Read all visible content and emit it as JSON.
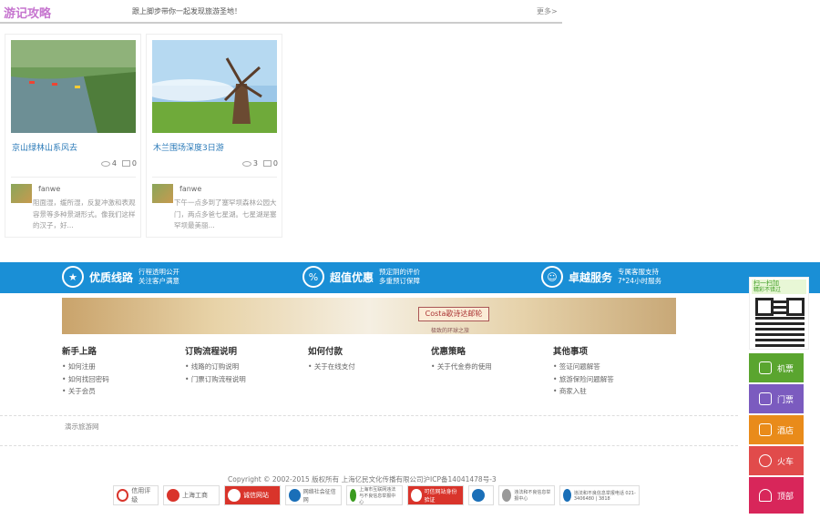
{
  "section": {
    "title": "游记攻略",
    "subtitle": "跟上脚步带你一起发现旅游圣地！",
    "more": "更多>"
  },
  "cards": [
    {
      "title": "京山绿林山系风去",
      "views": "4",
      "comments": "0",
      "user": "fanwe",
      "excerpt": "阻面湿，缓所湿，反复冲激和表观容景等多种景湖形式。像我们这样的汉子，好..."
    },
    {
      "title": "木兰围场深度3日游",
      "views": "3",
      "comments": "0",
      "user": "fanwe",
      "excerpt": "下午一点多到了塞罕坝森林公园大门，两点多爸七星湖。七星湖是塞罕坝最美丽..."
    }
  ],
  "features": [
    {
      "icon": "star-icon",
      "name": "优质线路",
      "line1": "行程透明公开",
      "line2": "关注客户满意"
    },
    {
      "icon": "hanger-icon",
      "name": "超值优惠",
      "line1": "预定阴的评价",
      "line2": "多重预订保障"
    },
    {
      "icon": "service-icon",
      "name": "卓越服务",
      "line1": "专属客服支持",
      "line2": "7*24小时服务"
    }
  ],
  "banner": {
    "logo": "Costa歌诗达邮轮",
    "tagline": "极致的环球之旅"
  },
  "footer_columns": [
    {
      "heading": "新手上路",
      "links": [
        "如何注册",
        "如何找回密码",
        "关于会员"
      ]
    },
    {
      "heading": "订购流程说明",
      "links": [
        "线路的订购说明",
        "门票订购流程说明"
      ]
    },
    {
      "heading": "如何付款",
      "links": [
        "关于在线支付"
      ]
    },
    {
      "heading": "优惠策略",
      "links": [
        "关于代金券的使用"
      ]
    },
    {
      "heading": "其他事项",
      "links": [
        "签证问题解答",
        "旅游保险问题解答",
        "商家入驻"
      ]
    }
  ],
  "friend_link": "演示旅游网",
  "copyright": "Copyright © 2002-2015 版权所有 上海亿民文化传播有限公司沪ICP备14041478号-3",
  "badges": [
    {
      "label": "信用评级",
      "color": "#d9342b"
    },
    {
      "label": "上海工商",
      "color": "#d9342b"
    },
    {
      "label": "诚信网站",
      "color": "#d9342b"
    },
    {
      "label": "网络社会征信网",
      "color": "#1a6fb8"
    },
    {
      "label": "上海市互联网违法与不良信息举报中心",
      "color": "#3a9b1f"
    },
    {
      "label": "可信网站身份验证",
      "color": "#d9342b"
    },
    {
      "label": "",
      "color": "#1a6fb8"
    },
    {
      "label": "违法和不良信息举报中心",
      "color": "#999999"
    },
    {
      "label": "违法和不良信息举报电话 021-3406480 | 3818",
      "color": "#1a6fb8"
    }
  ],
  "sidebar": {
    "qr_title": "扫一扫加",
    "qr_sub": "精彩不错过",
    "buttons": [
      {
        "label": "机票",
        "color": "#5aa52f"
      },
      {
        "label": "门票",
        "color": "#7b5bbf"
      },
      {
        "label": "酒店",
        "color": "#e98b1a"
      },
      {
        "label": "火车",
        "color": "#e14b4b"
      },
      {
        "label": "顶部",
        "color": "#d8265a"
      }
    ]
  }
}
